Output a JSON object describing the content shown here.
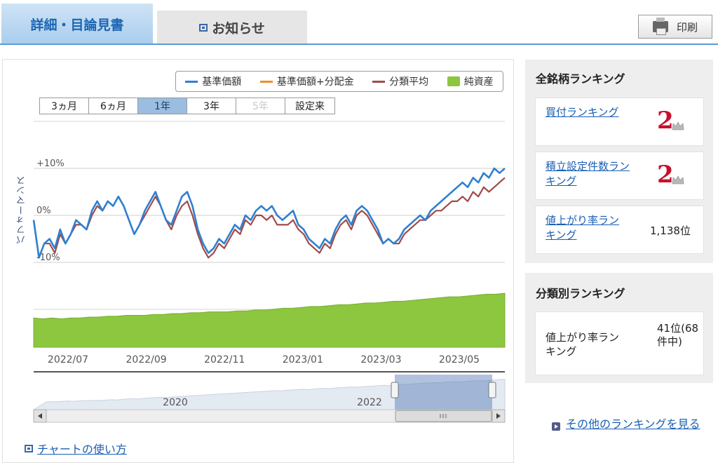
{
  "tabs": [
    {
      "label": "詳細・目論見書",
      "active": true
    },
    {
      "label": "お知らせ",
      "active": false
    }
  ],
  "print_label": "印刷",
  "legend": [
    {
      "label": "基準価額",
      "color": "#2f80d1"
    },
    {
      "label": "基準価額+分配金",
      "color": "#f28c28"
    },
    {
      "label": "分類平均",
      "color": "#a14a4a"
    },
    {
      "label": "純資産",
      "color": "#8dc63f"
    }
  ],
  "periods": [
    {
      "label": "3ヵ月",
      "state": "normal"
    },
    {
      "label": "6ヵ月",
      "state": "normal"
    },
    {
      "label": "1年",
      "state": "active"
    },
    {
      "label": "3年",
      "state": "normal"
    },
    {
      "label": "5年",
      "state": "disabled"
    },
    {
      "label": "設定来",
      "state": "normal"
    }
  ],
  "y_axis_label": "パフォーマンス",
  "chart_link": "チャートの使い方",
  "chart_data": {
    "type": "line",
    "x_ticks": [
      "2022/07",
      "2022/09",
      "2022/11",
      "2023/01",
      "2023/03",
      "2023/05"
    ],
    "y_ticks": [
      "+10%",
      "0%",
      "-10%"
    ],
    "ylim": [
      -10,
      10
    ],
    "grid": true,
    "legend_position": "top-right",
    "series": [
      {
        "name": "基準価額",
        "color": "#2f80d1",
        "values": [
          -1,
          -9,
          -6,
          -5,
          -7,
          -3,
          -6,
          -4,
          -1,
          -2,
          -3,
          1,
          3,
          1,
          3,
          2,
          4,
          2,
          -1,
          -4,
          -2,
          1,
          3,
          5,
          2,
          -1,
          -2,
          1,
          4,
          5,
          2,
          -3,
          -6,
          -8,
          -7,
          -5,
          -6,
          -4,
          -2,
          -3,
          0,
          -1,
          1,
          2,
          1,
          2,
          0,
          -1,
          0,
          1,
          -2,
          -3,
          -5,
          -6,
          -7,
          -5,
          -6,
          -3,
          -1,
          0,
          -2,
          1,
          2,
          1,
          -1,
          -3,
          -6,
          -5,
          -6,
          -5,
          -3,
          -2,
          -1,
          0,
          -1,
          1,
          2,
          3,
          4,
          5,
          6,
          7,
          6,
          8,
          7,
          9,
          8,
          10,
          9,
          10
        ]
      },
      {
        "name": "分類平均",
        "color": "#a14a4a",
        "values": [
          -1,
          -9,
          -6,
          -6,
          -8,
          -4,
          -6,
          -4,
          -2,
          -2,
          -3,
          0,
          2,
          1,
          3,
          2,
          4,
          2,
          -1,
          -4,
          -2,
          0,
          2,
          4,
          2,
          -1,
          -3,
          0,
          2,
          3,
          0,
          -4,
          -7,
          -9,
          -8,
          -6,
          -7,
          -5,
          -3,
          -4,
          -1,
          -2,
          0,
          0,
          -1,
          0,
          -2,
          -2,
          -2,
          -1,
          -3,
          -4,
          -6,
          -7,
          -8,
          -6,
          -7,
          -4,
          -2,
          -1,
          -3,
          0,
          1,
          0,
          -2,
          -4,
          -6,
          -5,
          -6,
          -6,
          -4,
          -3,
          -2,
          -1,
          -1,
          0,
          1,
          1,
          2,
          3,
          3,
          4,
          3,
          5,
          4,
          6,
          5,
          6,
          7,
          8
        ]
      }
    ],
    "net_assets": [
      3,
      2,
      3,
      2,
      3,
      3,
      4,
      4,
      5,
      5,
      6,
      6,
      6,
      7,
      7,
      8,
      8,
      9,
      9,
      10,
      10,
      10,
      11,
      11,
      12,
      12,
      13,
      14,
      14,
      15,
      16,
      16,
      17,
      18,
      18,
      19,
      20,
      20,
      21,
      22,
      22,
      23,
      24,
      25,
      26,
      27,
      27,
      28,
      29,
      30,
      30,
      31
    ],
    "navigator": {
      "year_labels": [
        "2020",
        "2022"
      ],
      "values": [
        2,
        3,
        3,
        4,
        5,
        4,
        5,
        6,
        7,
        6,
        7,
        8,
        9,
        8,
        10,
        11,
        12,
        11,
        13,
        14,
        15,
        16,
        15,
        17,
        18,
        19,
        20,
        21,
        22,
        23,
        24,
        25,
        26,
        27,
        28,
        29,
        30,
        31,
        32,
        33,
        34,
        35,
        36,
        35,
        37,
        38,
        39,
        40,
        39,
        41,
        42,
        43,
        42,
        44,
        45,
        46,
        47,
        46,
        48,
        49,
        50,
        51,
        52,
        51,
        53,
        54,
        55,
        56,
        57,
        58,
        59,
        60,
        59,
        61,
        62,
        63,
        62,
        64,
        65,
        66,
        65,
        67,
        68,
        69,
        70
      ]
    }
  },
  "ranking": {
    "title": "全銘柄ランキング",
    "items": [
      {
        "label": "買付ランキング",
        "rank": "2",
        "crown": true
      },
      {
        "label": "積立設定件数ランキング",
        "rank": "2",
        "crown": true
      },
      {
        "label": "値上がり率ランキング",
        "rank": "1,138位",
        "crown": false
      }
    ]
  },
  "category": {
    "title": "分類別ランキング",
    "label": "値上がり率ランキング",
    "rank": "41位(68件中)"
  },
  "more_link": "その他のランキングを見る"
}
